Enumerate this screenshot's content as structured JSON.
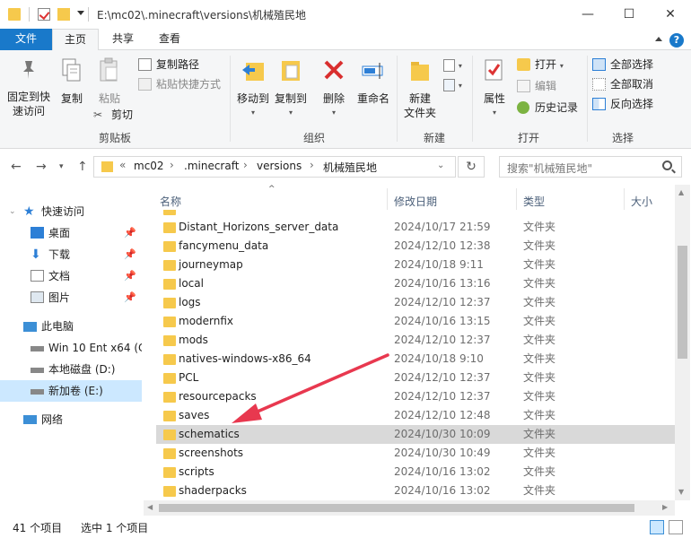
{
  "window": {
    "title": "E:\\mc02\\.minecraft\\versions\\机械殖民地",
    "minimize": "—",
    "maximize": "☐",
    "close": "✕"
  },
  "ribbon_tabs": [
    "文件",
    "主页",
    "共享",
    "查看"
  ],
  "ribbon": {
    "clipboard": {
      "label": "剪贴板",
      "pin_quick": "固定到快\n速访问",
      "copy": "复制",
      "paste": "粘贴",
      "copy_path": "复制路径",
      "paste_shortcut": "粘贴快捷方式",
      "cut": "剪切"
    },
    "organize": {
      "label": "组织",
      "move_to": "移动到",
      "copy_to": "复制到",
      "delete": "删除",
      "rename": "重命名"
    },
    "new": {
      "label": "新建",
      "new_folder": "新建\n文件夹"
    },
    "open": {
      "label": "打开",
      "properties": "属性",
      "open": "打开",
      "edit": "编辑",
      "history": "历史记录"
    },
    "select": {
      "label": "选择",
      "select_all": "全部选择",
      "select_none": "全部取消",
      "invert": "反向选择"
    }
  },
  "address": {
    "crumbs": [
      "mc02",
      ".minecraft",
      "versions",
      "机械殖民地"
    ],
    "overflow": "«"
  },
  "search": {
    "placeholder": "搜索\"机械殖民地\""
  },
  "nav": {
    "quick_access": "快速访问",
    "quick_items": [
      "桌面",
      "下载",
      "文档",
      "图片"
    ],
    "this_pc": "此电脑",
    "drives": [
      "Win 10 Ent x64 (C",
      "本地磁盘 (D:)",
      "新加卷 (E:)"
    ],
    "network": "网络"
  },
  "columns": {
    "name": "名称",
    "date": "修改日期",
    "type": "类型",
    "size": "大小"
  },
  "files": [
    {
      "name": "Distant_Horizons_server_data",
      "date": "2024/10/17 21:59",
      "type": "文件夹"
    },
    {
      "name": "fancymenu_data",
      "date": "2024/12/10 12:38",
      "type": "文件夹"
    },
    {
      "name": "journeymap",
      "date": "2024/10/18 9:11",
      "type": "文件夹"
    },
    {
      "name": "local",
      "date": "2024/10/16 13:16",
      "type": "文件夹"
    },
    {
      "name": "logs",
      "date": "2024/12/10 12:37",
      "type": "文件夹"
    },
    {
      "name": "modernfix",
      "date": "2024/10/16 13:15",
      "type": "文件夹"
    },
    {
      "name": "mods",
      "date": "2024/12/10 12:37",
      "type": "文件夹"
    },
    {
      "name": "natives-windows-x86_64",
      "date": "2024/10/18 9:10",
      "type": "文件夹"
    },
    {
      "name": "PCL",
      "date": "2024/12/10 12:37",
      "type": "文件夹"
    },
    {
      "name": "resourcepacks",
      "date": "2024/12/10 12:37",
      "type": "文件夹"
    },
    {
      "name": "saves",
      "date": "2024/12/10 12:48",
      "type": "文件夹"
    },
    {
      "name": "schematics",
      "date": "2024/10/30 10:09",
      "type": "文件夹"
    },
    {
      "name": "screenshots",
      "date": "2024/10/30 10:49",
      "type": "文件夹"
    },
    {
      "name": "scripts",
      "date": "2024/10/16 13:02",
      "type": "文件夹"
    },
    {
      "name": "shaderpacks",
      "date": "2024/10/16 13:02",
      "type": "文件夹"
    }
  ],
  "selected_file": "schematics",
  "status": {
    "count": "41 个项目",
    "selected": "选中 1 个项目"
  },
  "colors": {
    "accent": "#1979ca",
    "selection": "#d9d9d9",
    "nav_selection": "#cce8ff",
    "arrow": "#e8384f",
    "folder": "#f6c94c"
  }
}
